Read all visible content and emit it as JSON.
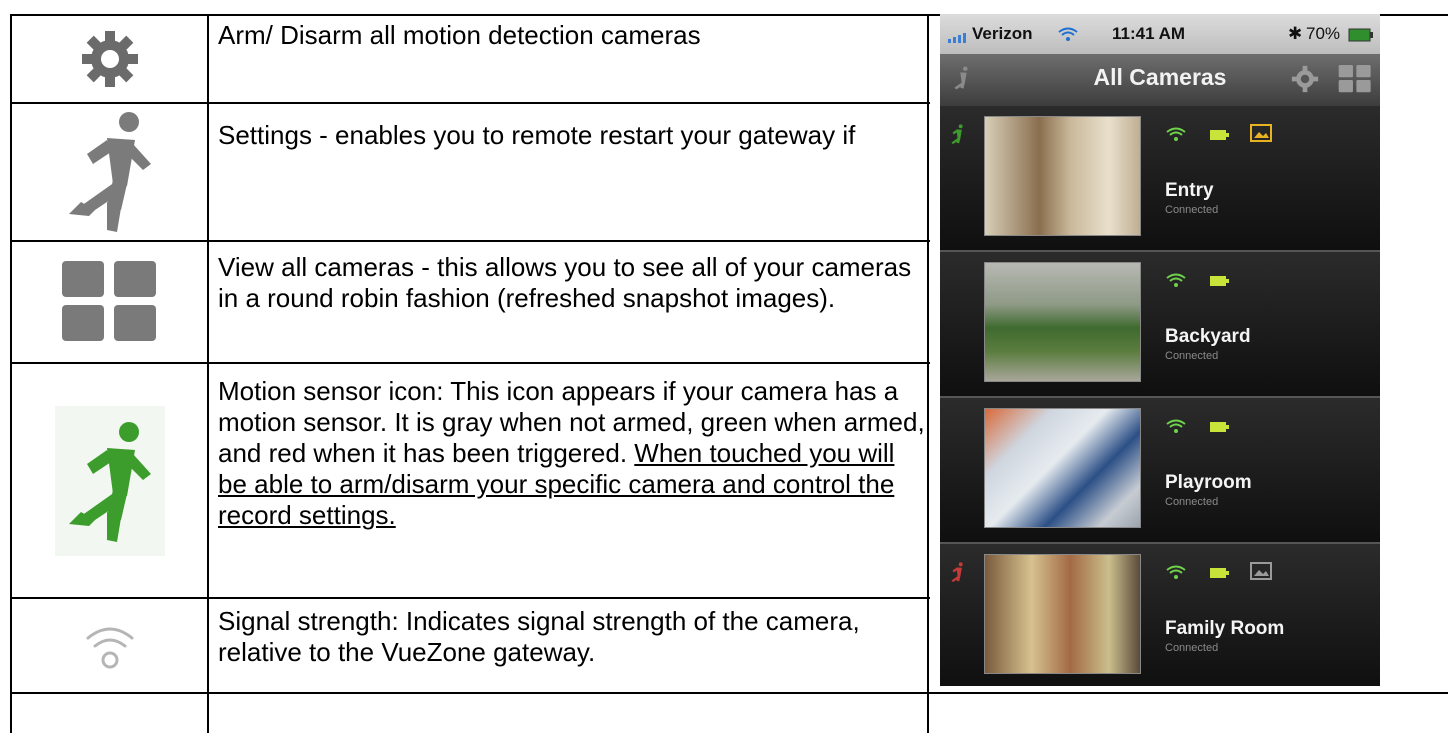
{
  "table": {
    "rows": [
      {
        "icon": "gear-icon",
        "paragraphs": [
          {
            "text": "Arm/ Disarm all motion detection cameras",
            "underline": false
          }
        ]
      },
      {
        "icon": "running-person-gray-icon",
        "paragraphs": [
          {
            "text": "Settings - enables you to remote restart your gateway if",
            "underline": false
          }
        ]
      },
      {
        "icon": "grid-view-icon",
        "paragraphs": [
          {
            "text": "View all cameras - this allows you to see all of your cameras in a round robin fashion (refreshed snapshot images).",
            "underline": false
          }
        ]
      },
      {
        "icon": "running-person-green-icon",
        "paragraphs": [
          {
            "text": "Motion sensor icon: This icon appears if your camera has a motion sensor.  It is gray when not armed, green when armed, and red when it has been triggered.",
            "underline": false
          },
          {
            "text": "When touched you will be able to arm/disarm your specific camera and control the record settings.",
            "underline": true
          }
        ]
      },
      {
        "icon": "wifi-signal-icon",
        "paragraphs": [
          {
            "text": "Signal strength: Indicates signal strength of the camera, relative to the VueZone gateway.",
            "underline": false
          }
        ]
      }
    ]
  },
  "phone": {
    "status": {
      "carrier": "Verizon",
      "time": "11:41 AM",
      "battery": "70%"
    },
    "nav_title": "All Cameras",
    "cameras": [
      {
        "name": "Entry",
        "status": "Connected",
        "motion": "green",
        "photo_icon": "yellow"
      },
      {
        "name": "Backyard",
        "status": "Connected",
        "motion": "none",
        "photo_icon": "none"
      },
      {
        "name": "Playroom",
        "status": "Connected",
        "motion": "none",
        "photo_icon": "none"
      },
      {
        "name": "Family Room",
        "status": "Connected",
        "motion": "red",
        "photo_icon": "gray"
      }
    ]
  },
  "colors": {
    "green": "#3c9c2c",
    "red": "#c63a3a",
    "gray": "#7a7a7a",
    "yellow": "#e8b322",
    "wifi_green": "#6fd24b"
  }
}
